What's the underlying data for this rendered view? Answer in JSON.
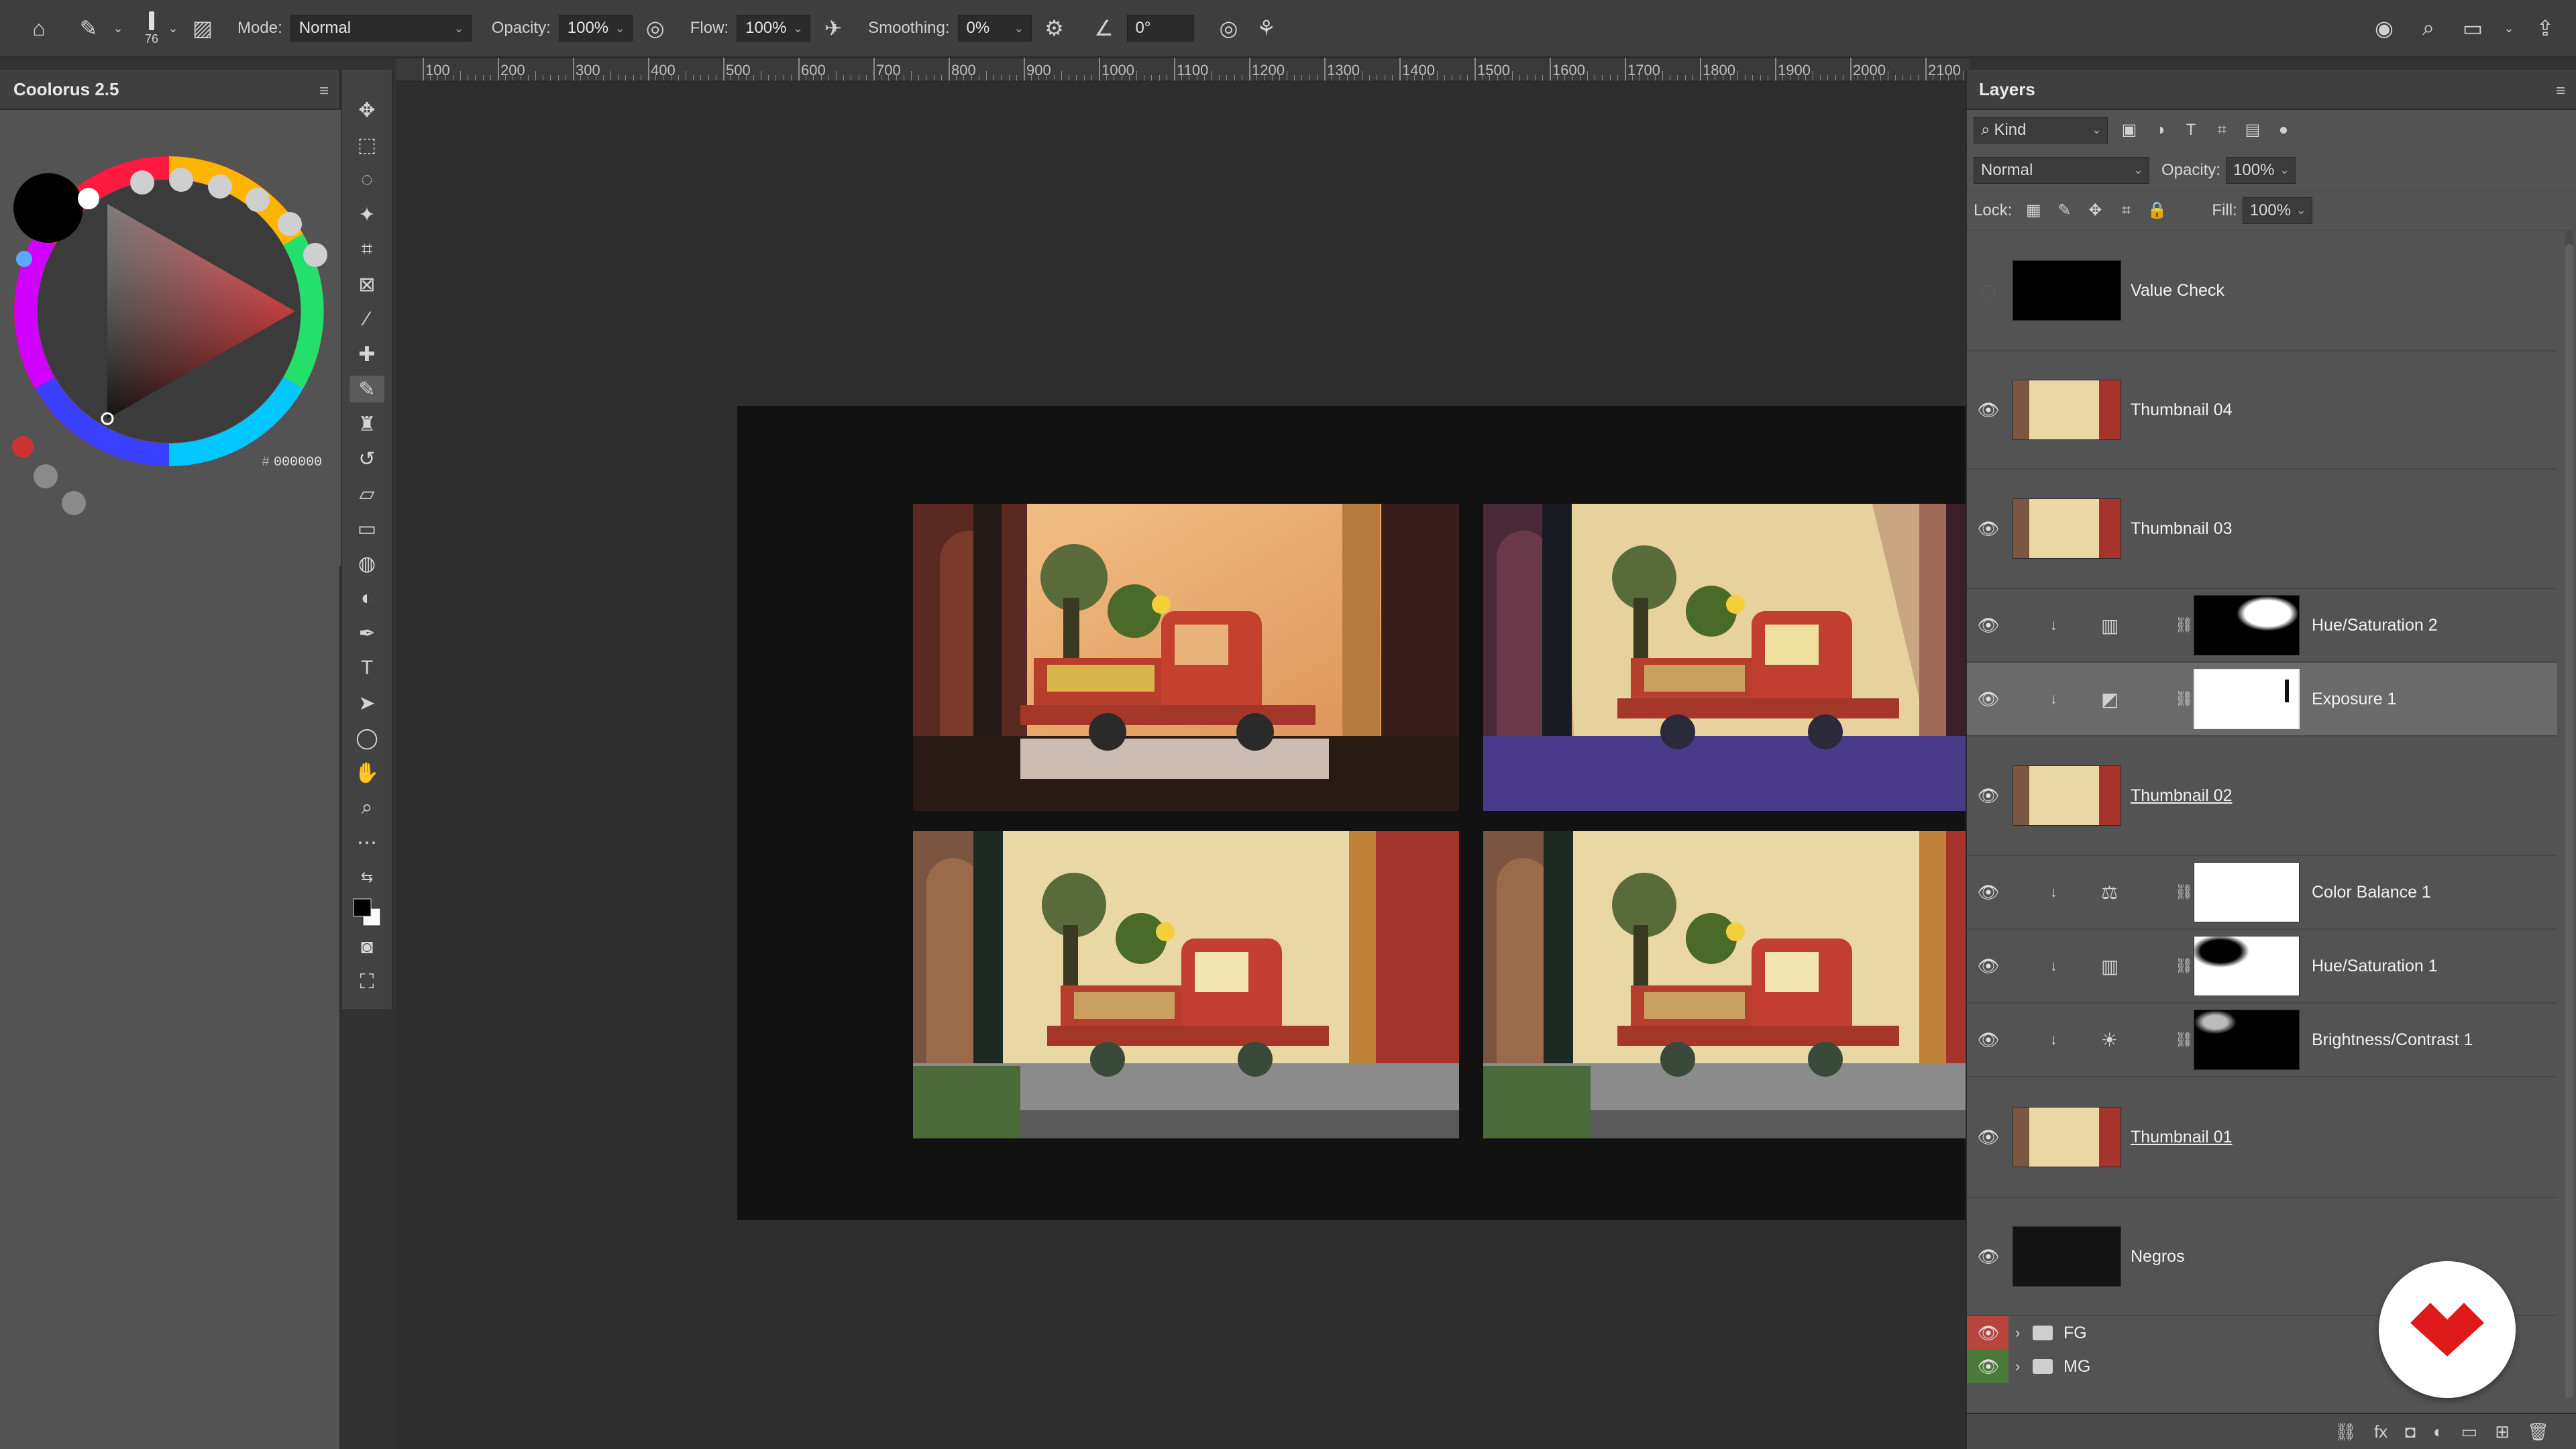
{
  "options_bar": {
    "brush_size": "76",
    "mode_label": "Mode:",
    "mode_value": "Normal",
    "opacity_label": "Opacity:",
    "opacity_value": "100%",
    "flow_label": "Flow:",
    "flow_value": "100%",
    "smoothing_label": "Smoothing:",
    "smoothing_value": "0%",
    "angle_value": "0°"
  },
  "colorus": {
    "title": "Coolorus 2.5",
    "hex_label": "#",
    "hex_value": "000000"
  },
  "ruler": {
    "ticks": [
      "100",
      "200",
      "300",
      "400",
      "500",
      "600",
      "700",
      "800",
      "900",
      "1000",
      "1100",
      "1200",
      "1300",
      "1400",
      "1500",
      "1600",
      "1700",
      "1800",
      "1900",
      "2000",
      "2100"
    ]
  },
  "layers_panel": {
    "title": "Layers",
    "filter_value": "Kind",
    "blend_mode": "Normal",
    "opacity_label": "Opacity:",
    "opacity_value": "100%",
    "lock_label": "Lock:",
    "fill_label": "Fill:",
    "fill_value": "100%",
    "layers": [
      {
        "name": "Value Check",
        "kind": "layer",
        "visible": false
      },
      {
        "name": "Thumbnail 04",
        "kind": "layer",
        "visible": true
      },
      {
        "name": "Thumbnail 03",
        "kind": "layer",
        "visible": true
      },
      {
        "name": "Hue/Saturation 2",
        "kind": "adjustment",
        "visible": true
      },
      {
        "name": "Exposure 1",
        "kind": "adjustment",
        "visible": true,
        "selected": true
      },
      {
        "name": "Thumbnail 02",
        "kind": "layer",
        "visible": true
      },
      {
        "name": "Color Balance 1",
        "kind": "adjustment",
        "visible": true
      },
      {
        "name": "Hue/Saturation 1",
        "kind": "adjustment",
        "visible": true
      },
      {
        "name": "Brightness/Contrast 1",
        "kind": "adjustment",
        "visible": true
      },
      {
        "name": "Thumbnail 01",
        "kind": "layer",
        "visible": true
      },
      {
        "name": "Negros",
        "kind": "layer",
        "visible": true
      }
    ],
    "groups": [
      {
        "name": "FG",
        "color": "#b8443e"
      },
      {
        "name": "MG",
        "color": "#4a7a3a"
      }
    ]
  },
  "colors": {
    "ui_bg": "#535353",
    "selected_row": "#6a6a6a",
    "artboard": "#121212",
    "brand_red": "#e0191b"
  }
}
